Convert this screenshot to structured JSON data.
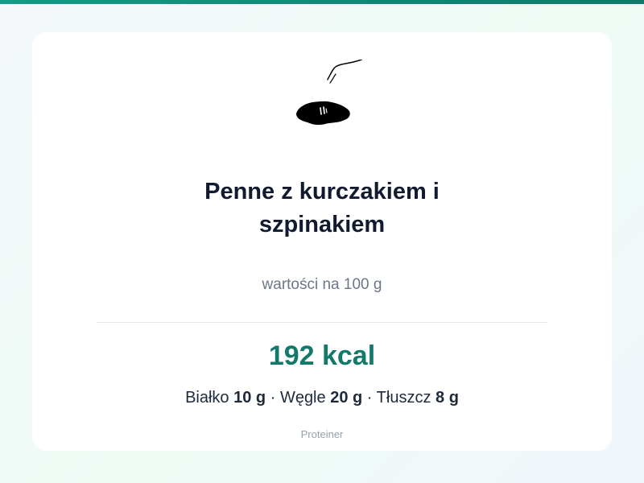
{
  "header": {
    "accent_color": "#149a86"
  },
  "card": {
    "image": {
      "icon": "dish-drawing-icon"
    },
    "title": "Penne z kurczakiem i szpinakiem",
    "subtitle": "wartości na 100 g",
    "calories": "192 kcal",
    "macros": {
      "protein_label": "Białko",
      "protein_value": "10 g",
      "carbs_label": "Węgle",
      "carbs_value": "20 g",
      "fat_label": "Tłuszcz",
      "fat_value": "8 g",
      "separator": "·"
    },
    "brand": "Proteiner"
  },
  "colors": {
    "accent": "#137a6b",
    "title": "#111a2e",
    "muted": "#6b7789",
    "card_background": "#ffffff"
  }
}
